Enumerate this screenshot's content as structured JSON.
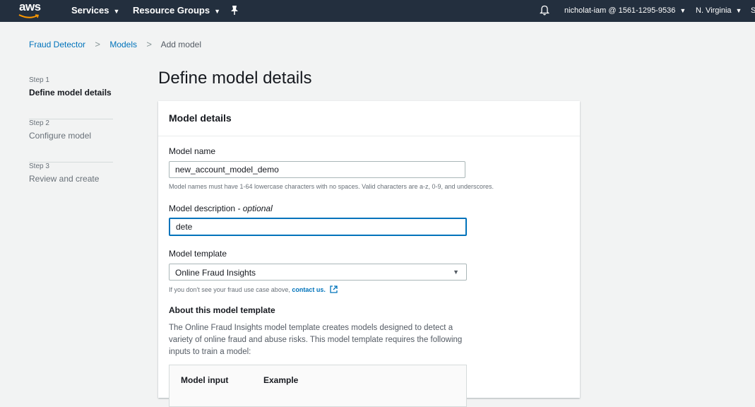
{
  "nav": {
    "logo": "aws",
    "services": "Services",
    "resource_groups": "Resource Groups",
    "account": "nicholat-iam @ 1561-1295-9536",
    "region": "N. Virginia",
    "edge_char": "S"
  },
  "breadcrumb": [
    "Fraud Detector",
    "Models",
    "Add model"
  ],
  "steps": [
    {
      "num": "Step 1",
      "title": "Define model details"
    },
    {
      "num": "Step 2",
      "title": "Configure model"
    },
    {
      "num": "Step 3",
      "title": "Review and create"
    }
  ],
  "page_title": "Define model details",
  "card": {
    "title": "Model details",
    "model_name_label": "Model name",
    "model_name_value": "new_account_model_demo",
    "model_name_hint": "Model names must have 1-64 lowercase characters with no spaces. Valid characters are a-z, 0-9, and underscores.",
    "desc_label": "Model description",
    "desc_optional": "- optional",
    "desc_value": "dete",
    "template_label": "Model template",
    "template_value": "Online Fraud Insights",
    "contact_hint": "If you don't see your fraud use case above,",
    "contact_link": "contact us.",
    "about_title": "About this model template",
    "about_text": "The Online Fraud Insights model template creates models designed to detect a variety of online fraud and abuse risks. This model template requires the following inputs to train a model:",
    "table_headers": [
      "Model input",
      "Example"
    ]
  },
  "colors": {
    "nav_bg": "#232f3e",
    "link": "#0073bb",
    "smile": "#ff9900"
  }
}
